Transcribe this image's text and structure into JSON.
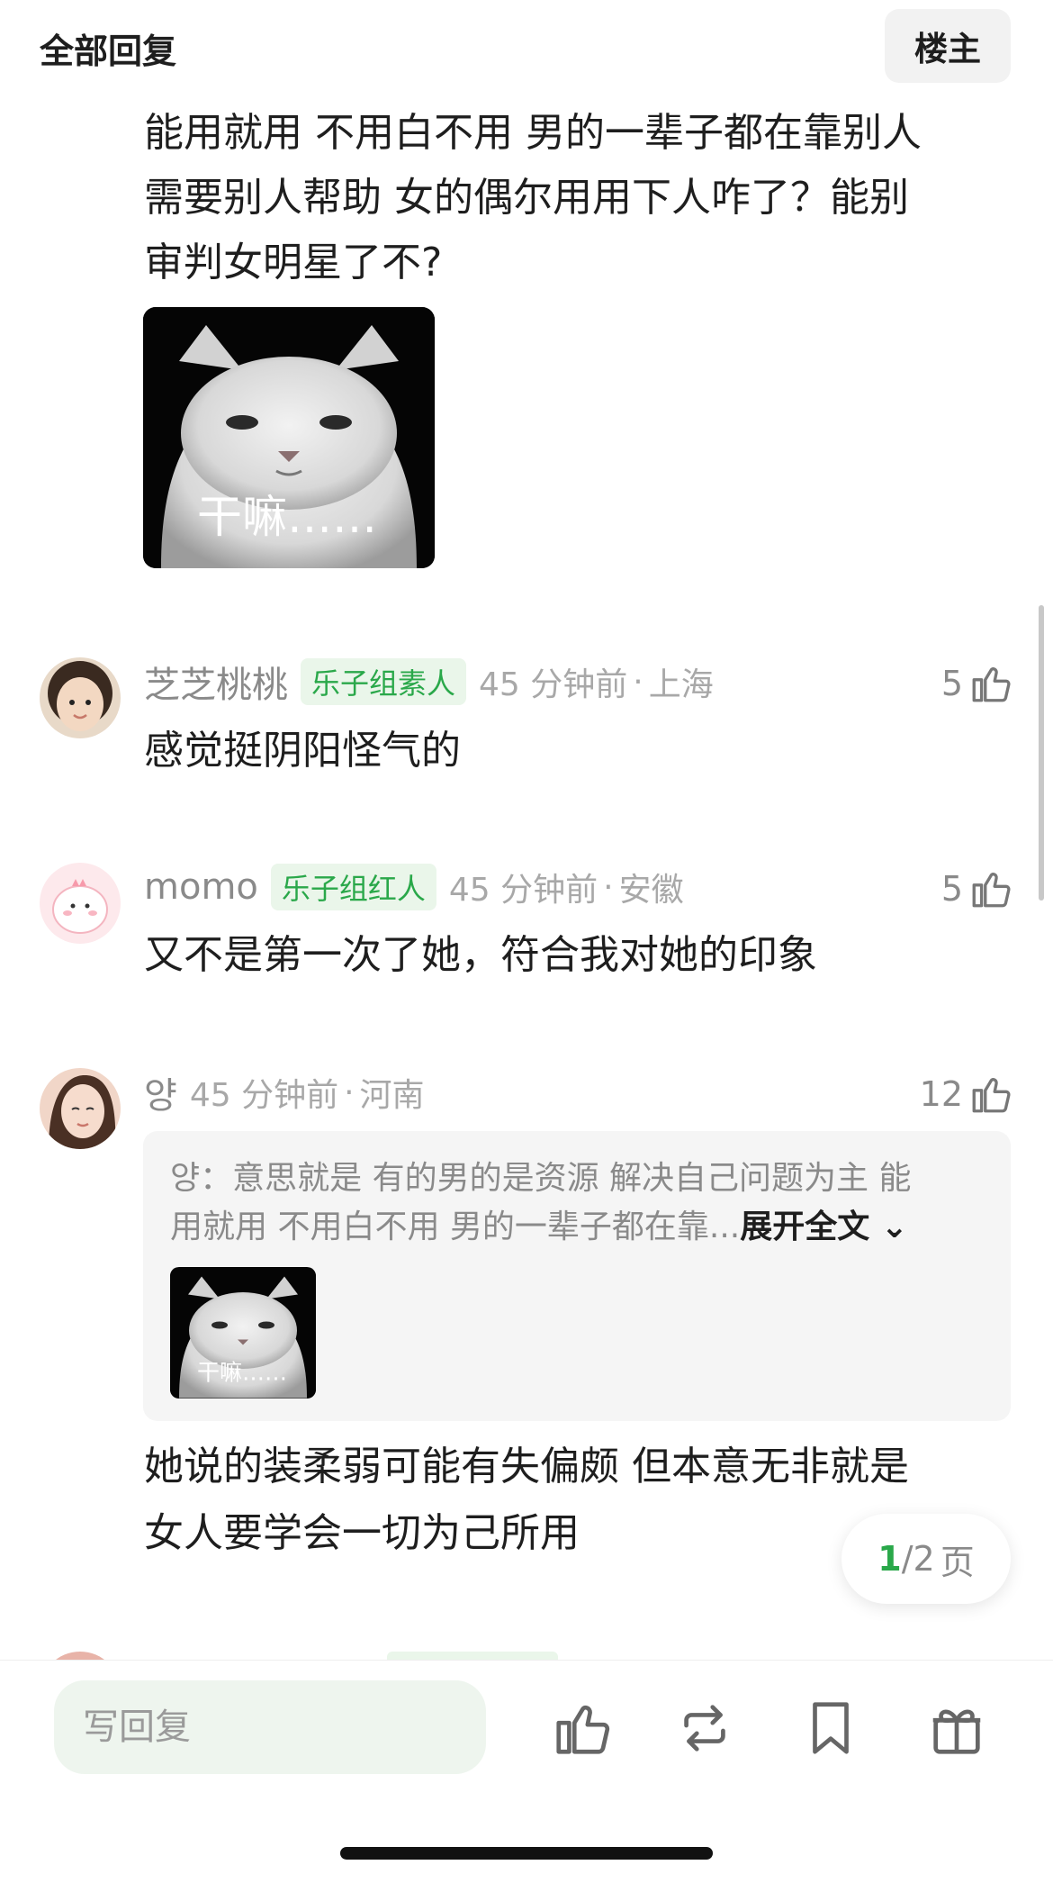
{
  "header": {
    "title": "全部回复",
    "owner_button": "楼主"
  },
  "post": {
    "text_lines": [
      "能用就用 不用白不用 男的一辈子都在靠别人",
      "需要别人帮助 女的偶尔用用下人咋了？能别",
      "审判女明星了不?"
    ],
    "meme_caption": "干嘛……"
  },
  "comments": [
    {
      "username": "芝芝桃桃",
      "badge": "乐子组素人",
      "time": "45 分钟前",
      "location": "上海",
      "likes": "5",
      "text": "感觉挺阴阳怪气的"
    },
    {
      "username": "momo",
      "badge": "乐子组红人",
      "time": "45 分钟前",
      "location": "安徽",
      "likes": "5",
      "text": "又不是第一次了她，符合我对她的印象"
    },
    {
      "username": "양",
      "time": "45 分钟前",
      "location": "河南",
      "likes": "12",
      "quote": {
        "line1": "양：意思就是 有的男的是资源 解决自己问题为主 能",
        "line2": "用就用 不用白不用 男的一辈子都在靠...",
        "expand": "展开全文",
        "meme_caption": "干嘛……"
      },
      "text_lines": [
        "她说的装柔弱可能有失偏颇 但本意无非就是",
        "女人要学会一切为己所用"
      ]
    }
  ],
  "pagination": {
    "current": "1",
    "total": "/2",
    "unit": "页"
  },
  "bottom_bar": {
    "reply_placeholder": "写回复",
    "icons": [
      "thumbs-up-icon",
      "repost-icon",
      "bookmark-icon",
      "gift-icon"
    ]
  },
  "colors": {
    "accent_green": "#2aa84a",
    "badge_bg": "#eaf6ea"
  }
}
